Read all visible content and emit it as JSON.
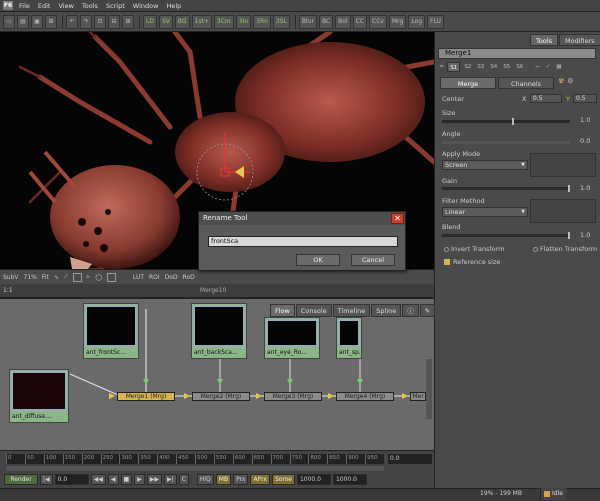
{
  "app": {
    "logo": "F6"
  },
  "menu": [
    "File",
    "Edit",
    "View",
    "Tools",
    "Script",
    "Window",
    "Help"
  ],
  "toolbar": {
    "left_buttons": [
      "▭",
      "▤",
      "▣",
      "⊞",
      "↶",
      "↷",
      "⊡",
      "⊟",
      "⊞"
    ],
    "mode_buttons": [
      "LD",
      "SV",
      "BG",
      "1st+",
      "3Cm",
      "3In",
      "3Rn",
      "3SL"
    ],
    "right_buttons": [
      "Blur",
      "BC",
      "Bol",
      "CC",
      "CCv",
      "Mrg",
      "Log",
      "FLU"
    ]
  },
  "viewer": {
    "toolbar_items": [
      "SubV",
      "71%",
      "Fit",
      "LUT",
      "ROI",
      "DoD",
      "RoD"
    ],
    "node_label": "Merge10",
    "scale": "1:1"
  },
  "dialog": {
    "title": "Rename Tool",
    "input_value": "frontSca",
    "ok_label": "OK",
    "cancel_label": "Cancel"
  },
  "flow": {
    "tabs": [
      "Flow",
      "Console",
      "Timeline",
      "Spline"
    ],
    "thumbnails": [
      {
        "label": "ant_frontSc..."
      },
      {
        "label": "ant_backSca..."
      },
      {
        "label": "ant_eye_Ro..."
      },
      {
        "label": "ant_sp..."
      },
      {
        "label": "ant_diffuse...."
      }
    ],
    "nodes": [
      {
        "label": "Merge1 (Mrg)",
        "selected": true
      },
      {
        "label": "Merge2 (Mrg)",
        "selected": false
      },
      {
        "label": "Merge3 (Mrg)",
        "selected": false
      },
      {
        "label": "Merge4 (Mrg)",
        "selected": false
      },
      {
        "label": "Mer",
        "selected": false
      }
    ]
  },
  "timeline": {
    "ticks": [
      "0",
      "50",
      "100",
      "150",
      "200",
      "250",
      "300",
      "350",
      "400",
      "450",
      "500",
      "550",
      "600",
      "650",
      "700",
      "750",
      "800",
      "850",
      "900",
      "950"
    ],
    "current_time": "0.0",
    "render_label": "Render",
    "transport_buttons": [
      "|◀",
      "◀◀",
      "◀",
      "■",
      "▶",
      "▶▶",
      "▶|"
    ],
    "start_field": "0.0",
    "loop_label": "C",
    "hiq_label": "HiQ",
    "mb_label": "MB",
    "prx_label": "Prx",
    "aprx_label": "APrx",
    "some_label": "Some",
    "end_field": "1000.0",
    "end_field2": "1000.0"
  },
  "status": {
    "memory": "19% - 199 MB",
    "state": "Idle"
  },
  "inspector": {
    "tabs": [
      "Tools",
      "Modifiers"
    ],
    "tool_name": "Merge1",
    "pages": [
      "S1",
      "S2",
      "S3",
      "S4",
      "S5",
      "S6"
    ],
    "content_tabs": [
      "Merge",
      "Channels"
    ],
    "center_label": "Center",
    "center_x_label": "X",
    "center_x": "0.5",
    "center_y_label": "Y",
    "center_y": "0.5",
    "size_label": "Size",
    "size_value": "1.0",
    "angle_label": "Angle",
    "angle_value": "0.0",
    "apply_mode_label": "Apply Mode",
    "apply_mode_value": "Screen",
    "gain_label": "Gain",
    "gain_value": "1.0",
    "filter_label": "Filter Method",
    "filter_value": "Linear",
    "blend_label": "Blend",
    "blend_value": "1.0",
    "invert_label": "Invert Transform",
    "flatten_label": "Flatten Transform",
    "reference_label": "Reference size"
  }
}
